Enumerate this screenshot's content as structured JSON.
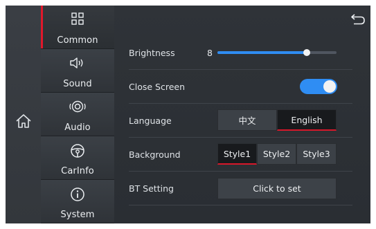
{
  "nav": {
    "items": [
      {
        "label": "Common",
        "icon": "grid-icon",
        "active": true
      },
      {
        "label": "Sound",
        "icon": "speaker-icon",
        "active": false
      },
      {
        "label": "Audio",
        "icon": "disc-icon",
        "active": false
      },
      {
        "label": "CarInfo",
        "icon": "steering-wheel-icon",
        "active": false
      },
      {
        "label": "System",
        "icon": "info-icon",
        "active": false
      }
    ]
  },
  "settings": {
    "brightness": {
      "label": "Brightness",
      "value": "8",
      "level": 0.75
    },
    "close_screen": {
      "label": "Close Screen",
      "enabled": true
    },
    "language": {
      "label": "Language",
      "options": [
        "中文",
        "English"
      ],
      "selected": "English"
    },
    "background": {
      "label": "Background",
      "options": [
        "Style1",
        "Style2",
        "Style3"
      ],
      "selected": "Style1"
    },
    "bt_setting": {
      "label": "BT Setting",
      "button_label": "Click to set"
    }
  },
  "colors": {
    "accent_blue": "#2f8df3",
    "accent_red": "#e0182b",
    "panel": "#2f3338"
  }
}
